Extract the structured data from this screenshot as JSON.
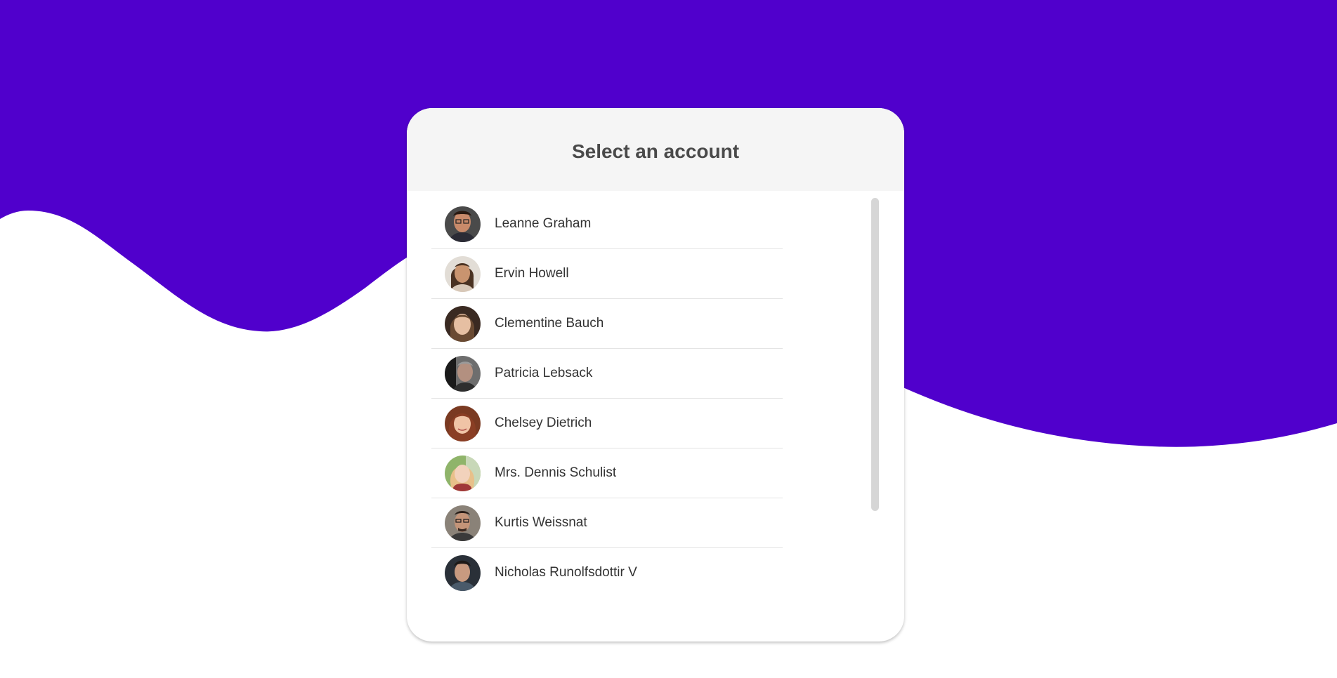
{
  "colors": {
    "brand_background": "#5000cc",
    "card_header_background": "#f5f5f5",
    "title_color": "#4a4a4a",
    "text_color": "#333333",
    "divider_color": "#e4e4e4",
    "scrollbar_thumb": "#d6d6d6"
  },
  "dialog": {
    "title": "Select an account"
  },
  "accounts": [
    {
      "name": "Leanne Graham",
      "avatar_icon": "avatar-photo-icon"
    },
    {
      "name": "Ervin Howell",
      "avatar_icon": "avatar-photo-icon"
    },
    {
      "name": "Clementine Bauch",
      "avatar_icon": "avatar-photo-icon"
    },
    {
      "name": "Patricia Lebsack",
      "avatar_icon": "avatar-photo-icon"
    },
    {
      "name": "Chelsey Dietrich",
      "avatar_icon": "avatar-photo-icon"
    },
    {
      "name": "Mrs. Dennis Schulist",
      "avatar_icon": "avatar-photo-icon"
    },
    {
      "name": "Kurtis Weissnat",
      "avatar_icon": "avatar-photo-icon"
    },
    {
      "name": "Nicholas Runolfsdottir V",
      "avatar_icon": "avatar-photo-icon"
    }
  ]
}
